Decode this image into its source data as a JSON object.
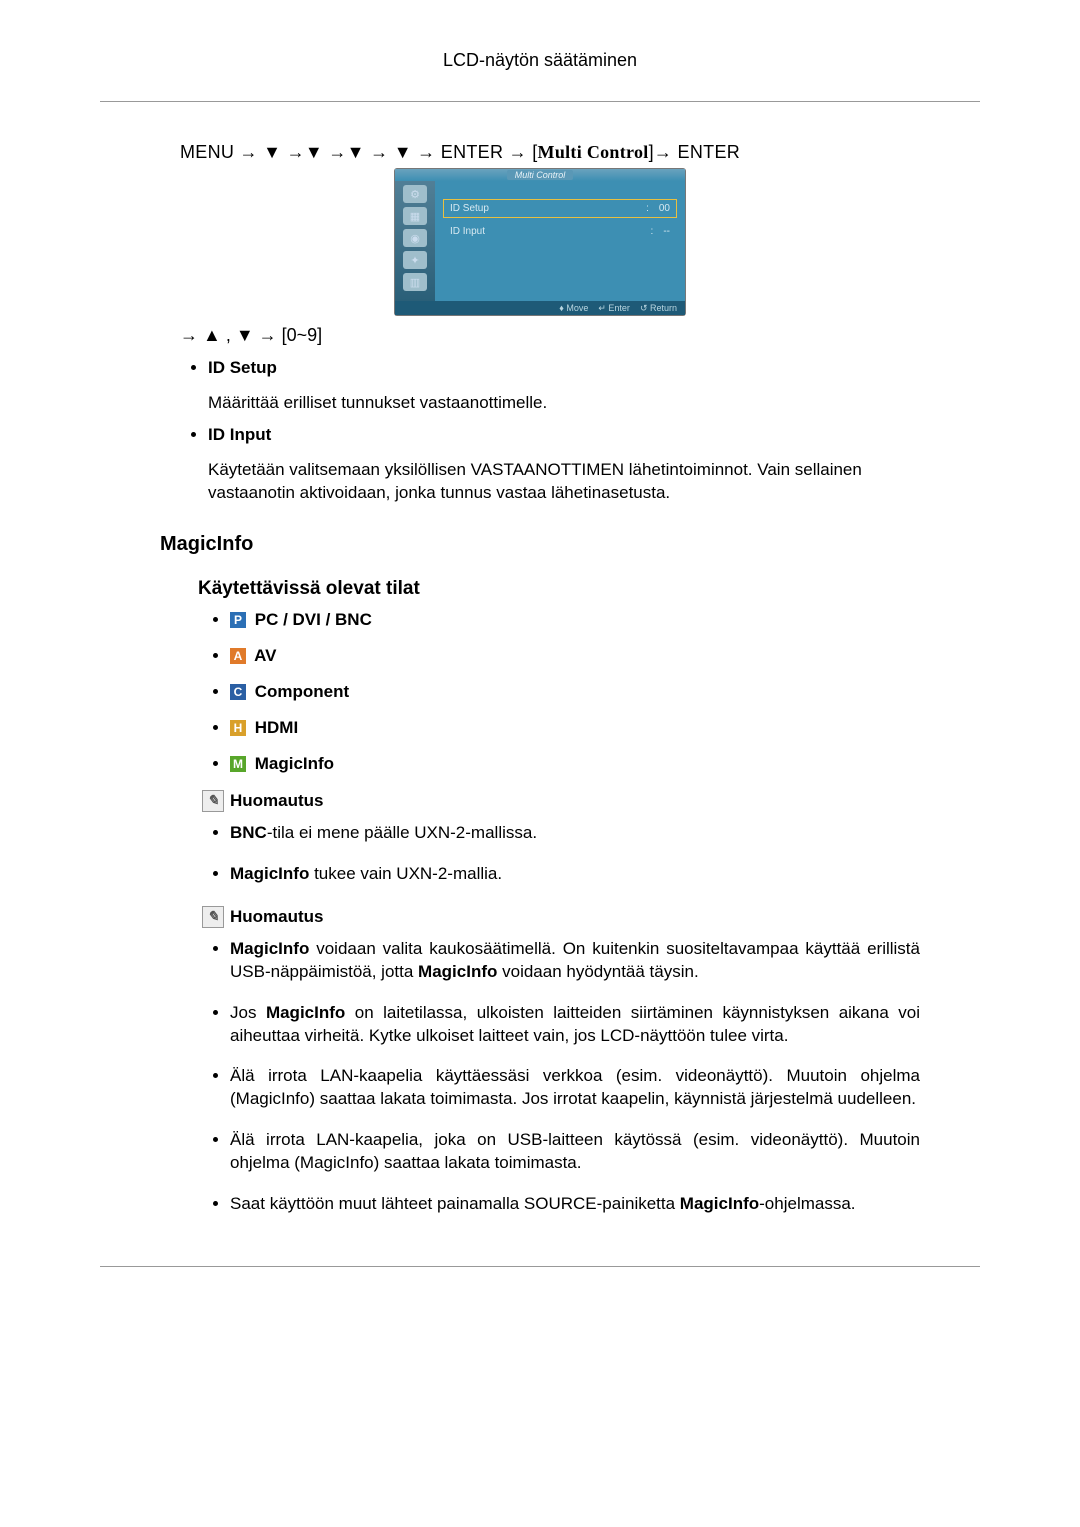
{
  "page": {
    "header": "LCD-näytön säätäminen"
  },
  "nav": {
    "menu": "MENU",
    "arrow": "→",
    "down": "▼",
    "up": "▲",
    "enter": "ENTER",
    "lbracket": "[",
    "rbracket": "]",
    "multi_control": "Multi Control",
    "range_line_prefix": "→ ▲ , ▼ → [0~9]"
  },
  "osd": {
    "title": "Multi Control",
    "fields": [
      {
        "label": "ID Setup",
        "value": "00"
      },
      {
        "label": "ID Input",
        "value": "--"
      }
    ],
    "footer": {
      "move": "Move",
      "enter": "Enter",
      "return": "Return"
    }
  },
  "definitions": [
    {
      "title": "ID Setup",
      "desc": "Määrittää erilliset tunnukset vastaanottimelle."
    },
    {
      "title": "ID Input",
      "desc": "Käytetään valitsemaan yksilöllisen VASTAANOTTIMEN lähetintoiminnot. Vain sellainen vastaanotin aktivoidaan, jonka tunnus vastaa lähetinasetusta."
    }
  ],
  "section": {
    "magicinfo": "MagicInfo",
    "modes_title": "Käytettävissä olevat tilat"
  },
  "modes": [
    {
      "badge": "P",
      "color": "#2b6fb5",
      "label": "PC / DVI / BNC"
    },
    {
      "badge": "A",
      "color": "#e07a2a",
      "label": "AV"
    },
    {
      "badge": "C",
      "color": "#2a5fa4",
      "label": "Component"
    },
    {
      "badge": "H",
      "color": "#d9a02a",
      "label": "HDMI"
    },
    {
      "badge": "M",
      "color": "#58a62a",
      "label": "MagicInfo"
    }
  ],
  "notes_label": "Huomautus",
  "notes1": [
    {
      "html": "<span class='b'>BNC</span>-tila ei mene päälle UXN-2-mallissa."
    },
    {
      "html": "<span class='b'>MagicInfo</span> tukee vain UXN-2-mallia."
    }
  ],
  "notes2": [
    {
      "html": "<span class='b'>MagicInfo</span> voidaan valita kaukosäätimellä. On kuitenkin suositeltavampaa käyttää erillistä USB-näppäimistöä, jotta <span class='b'>MagicInfo</span> voidaan hyödyntää täysin."
    },
    {
      "html": "Jos <span class='b'>MagicInfo</span> on laitetilassa, ulkoisten laitteiden siirtäminen käynnistyksen aikana voi aiheuttaa virheitä. Kytke ulkoiset laitteet vain, jos LCD-näyttöön tulee virta."
    },
    {
      "html": "Älä irrota LAN-kaapelia käyttäessäsi verkkoa (esim. videonäyttö). Muutoin ohjelma (MagicInfo) saattaa lakata toimimasta. Jos irrotat kaapelin, käynnistä järjestelmä uudelleen."
    },
    {
      "html": "Älä irrota LAN-kaapelia, joka on USB-laitteen käytössä (esim. videonäyttö). Muutoin ohjelma (MagicInfo) saattaa lakata toimimasta."
    },
    {
      "html": "Saat käyttöön muut lähteet painamalla SOURCE-painiketta <span class='b'>MagicInfo</span>-ohjelmassa."
    }
  ]
}
